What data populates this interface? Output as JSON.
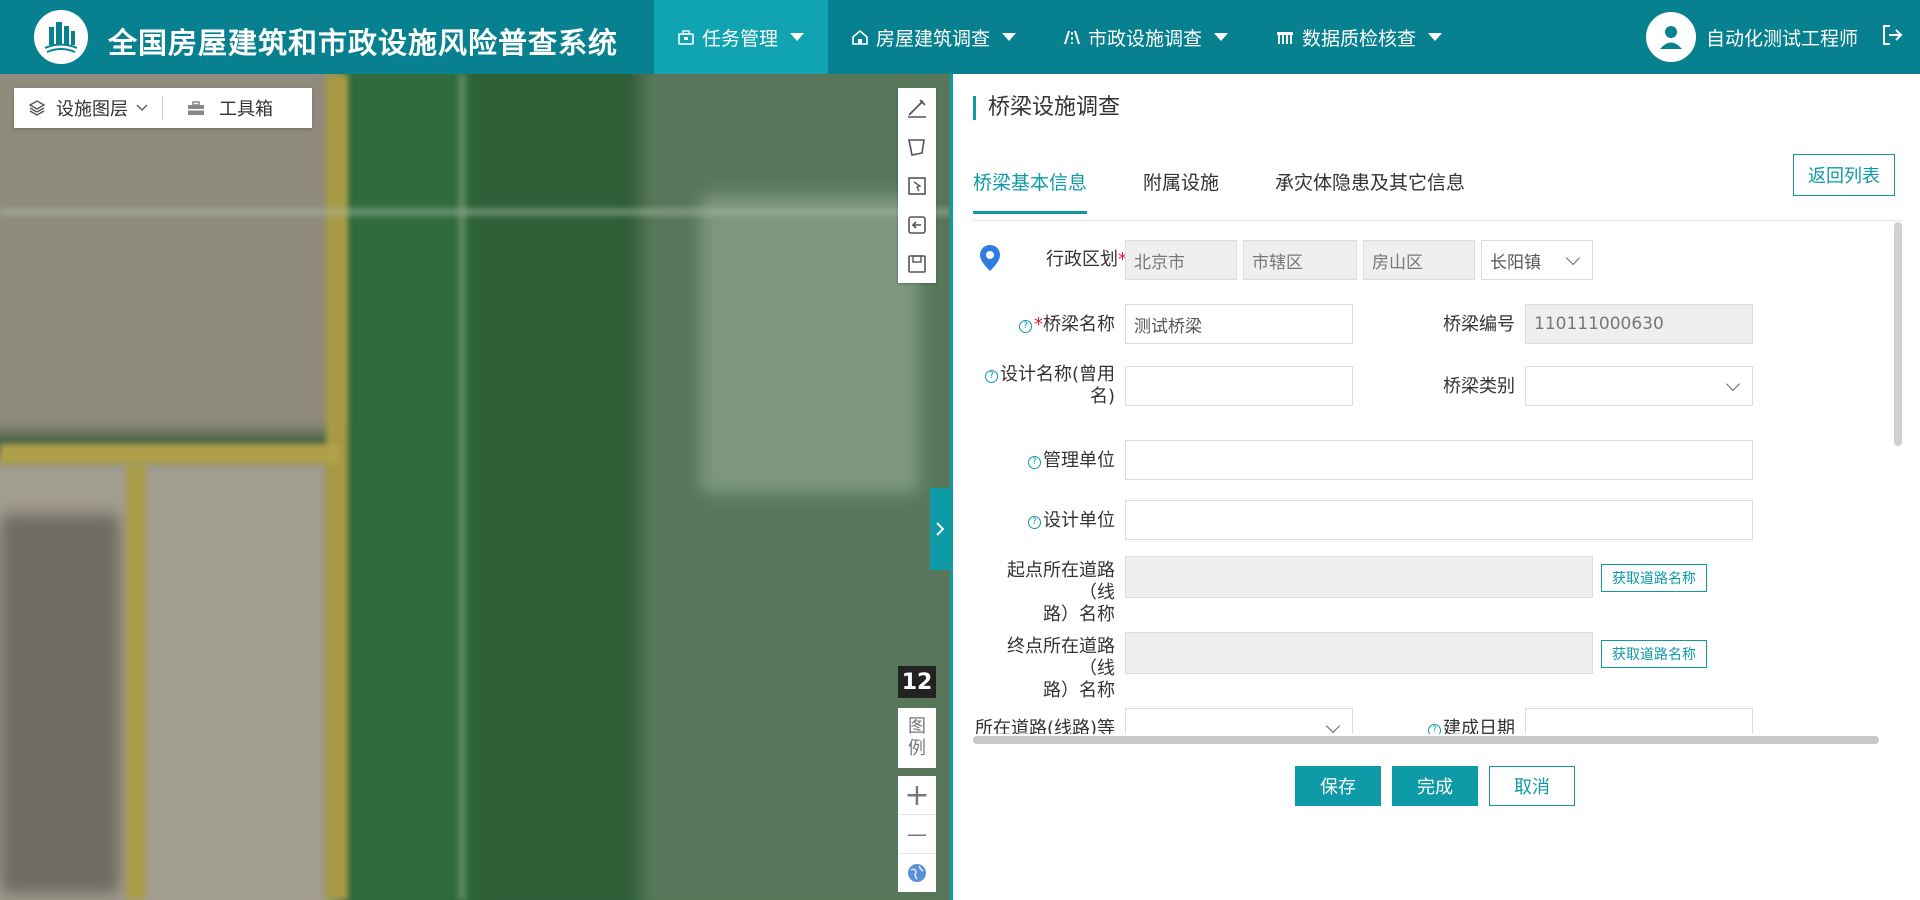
{
  "header": {
    "title": "全国房屋建筑和市政设施风险普查系统",
    "nav": [
      {
        "label": "任务管理",
        "icon": "briefcase-icon"
      },
      {
        "label": "房屋建筑调查",
        "icon": "house-icon"
      },
      {
        "label": "市政设施调查",
        "icon": "road-icon"
      },
      {
        "label": "数据质检核查",
        "icon": "bridge-icon"
      }
    ],
    "active_nav": "任务管理",
    "username": "自动化测试工程师",
    "colors": {
      "header_bg": "#07818f",
      "active_nav_bg": "#10a3b1",
      "accent": "#0f9aa8"
    }
  },
  "map": {
    "layers_label": "设施图层",
    "toolbox_label": "工具箱",
    "zoom_level": "12",
    "legend_label_1": "图",
    "legend_label_2": "例",
    "zoom_in": "+",
    "zoom_out": "—"
  },
  "panel": {
    "title": "桥梁设施调查",
    "back_label": "返回列表",
    "tabs": [
      "桥梁基本信息",
      "附属设施",
      "承灾体隐患及其它信息"
    ],
    "form": {
      "admin_region_label": "行政区划",
      "province": "北京市",
      "city": "市辖区",
      "district": "房山区",
      "town": "长阳镇",
      "bridge_name_label": "桥梁名称",
      "bridge_name_value": "测试桥梁",
      "bridge_code_label": "桥梁编号",
      "bridge_code_value": "110111000630",
      "design_name_label_1": "设计名称(曾用",
      "design_name_label_2": "名)",
      "bridge_type_label": "桥梁类别",
      "mgmt_unit_label": "管理单位",
      "design_unit_label": "设计单位",
      "start_road_label_1": "起点所在道路（线",
      "start_road_label_2": "路）名称",
      "end_road_label_1": "终点所在道路（线",
      "end_road_label_2": "路）名称",
      "get_road_btn": "获取道路名称",
      "road_grade_label": "所在道路(线路)等",
      "built_date_label": "建成日期"
    },
    "actions": {
      "save": "保存",
      "finish": "完成",
      "cancel": "取消"
    }
  }
}
